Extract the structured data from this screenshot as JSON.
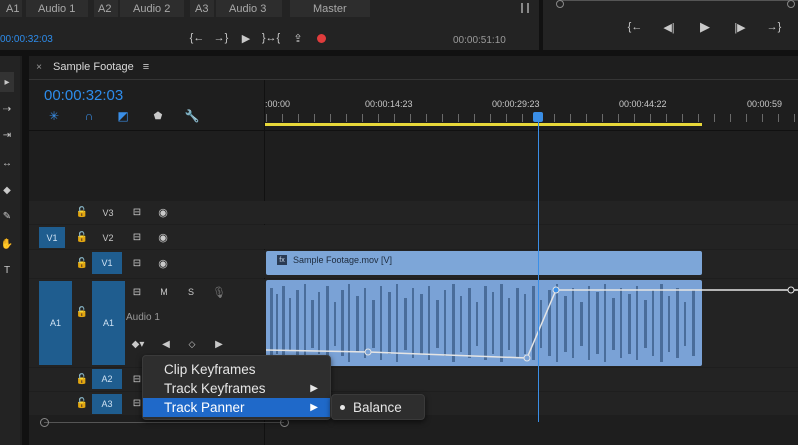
{
  "top_tabs": {
    "a1": "A1",
    "audio1": "Audio 1",
    "a2": "A2",
    "audio2": "Audio 2",
    "a3": "A3",
    "audio3": "Audio 3",
    "master": "Master"
  },
  "source_monitor": {
    "current_tc": "00:00:32:03",
    "duration_tc": "00:00:51:10"
  },
  "timeline": {
    "tab_title": "Sample Footage",
    "current_tc": "00:00:32:03",
    "ruler": [
      ":00:00",
      "00:00:14:23",
      "00:00:29:23",
      "00:00:44:22",
      "00:00:59"
    ],
    "clip_label": "Sample Footage.mov [V]"
  },
  "tracks": {
    "v3": "V3",
    "v2": "V2",
    "v1": "V1",
    "v1_src": "V1",
    "a1": "A1",
    "a1_src": "A1",
    "a2": "A2",
    "a3": "A3",
    "audio1_name": "Audio 1",
    "mute": "M",
    "solo": "S"
  },
  "context_menu": {
    "items": [
      "Clip Keyframes",
      "Track Keyframes",
      "Track Panner"
    ],
    "submenu": [
      "Balance"
    ]
  },
  "colors": {
    "accent": "#2d8ceb",
    "clip": "#7da6d8",
    "playhead": "#3a8ee6",
    "record": "#e03c3c",
    "work_area": "#e8d83a"
  }
}
